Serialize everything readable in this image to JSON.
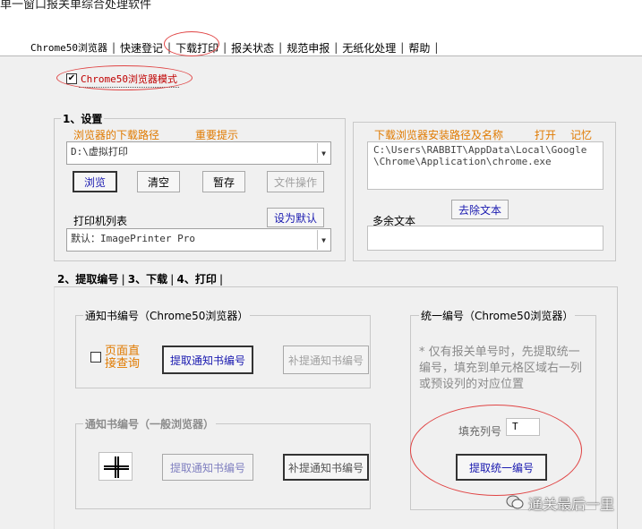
{
  "window": {
    "title": "单一窗口报关单综合处理软件"
  },
  "menu_tabs": [
    {
      "label": "Chrome50浏览器"
    },
    {
      "label": "快速登记"
    },
    {
      "label": "下载打印"
    },
    {
      "label": "报关状态"
    },
    {
      "label": "规范申报"
    },
    {
      "label": "无纸化处理"
    },
    {
      "label": "帮助"
    }
  ],
  "chrome_mode": {
    "label": "Chrome50浏览器模式",
    "checked": true,
    "check_mark": "✔"
  },
  "settings": {
    "title": "1、设置",
    "download_path_label": "浏览器的下载路径",
    "important_tip_label": "重要提示",
    "download_path_value": "D:\\虚拟打印",
    "buttons": {
      "browse": "浏览",
      "clear": "清空",
      "save_temp": "暂存",
      "file_ops": "文件操作",
      "set_default": "设为默认"
    },
    "printer_list_label": "打印机列表",
    "printer_value": "默认：ImagePrinter Pro"
  },
  "browser_install": {
    "title": "下载浏览器安装路径及名称",
    "open_label": "打开",
    "remember_label": "记忆",
    "path_value": "C:\\Users\\RABBIT\\AppData\\Local\\Google\\Chrome\\Application\\chrome.exe",
    "remove_text_button": "去除文本",
    "extra_text_label": "多余文本"
  },
  "inner_tabs": [
    {
      "label": "2、提取编号",
      "active": true
    },
    {
      "label": "3、下载"
    },
    {
      "label": "4、打印"
    }
  ],
  "notice_chrome": {
    "title": "通知书编号（Chrome50浏览器）",
    "page_query_label": "页面直接查询",
    "extract_button": "提取通知书编号",
    "supplement_button": "补提通知书编号"
  },
  "notice_general": {
    "title": "通知书编号（一般浏览器）",
    "extract_button": "提取通知书编号",
    "supplement_button": "补提通知书编号"
  },
  "unified": {
    "title": "统一编号（Chrome50浏览器）",
    "note": "* 仅有报关单号时，先提取统一编号，填充到单元格区域右一列或预设列的对应位置",
    "fill_column_label": "填充列号",
    "fill_column_value": "T",
    "extract_button": "提取统一编号"
  },
  "watermark": {
    "text": "通关最后一里"
  },
  "colors": {
    "accent_red": "#e04444",
    "orange_label": "#e07a00",
    "blue_button_text": "#1a1ab0"
  }
}
